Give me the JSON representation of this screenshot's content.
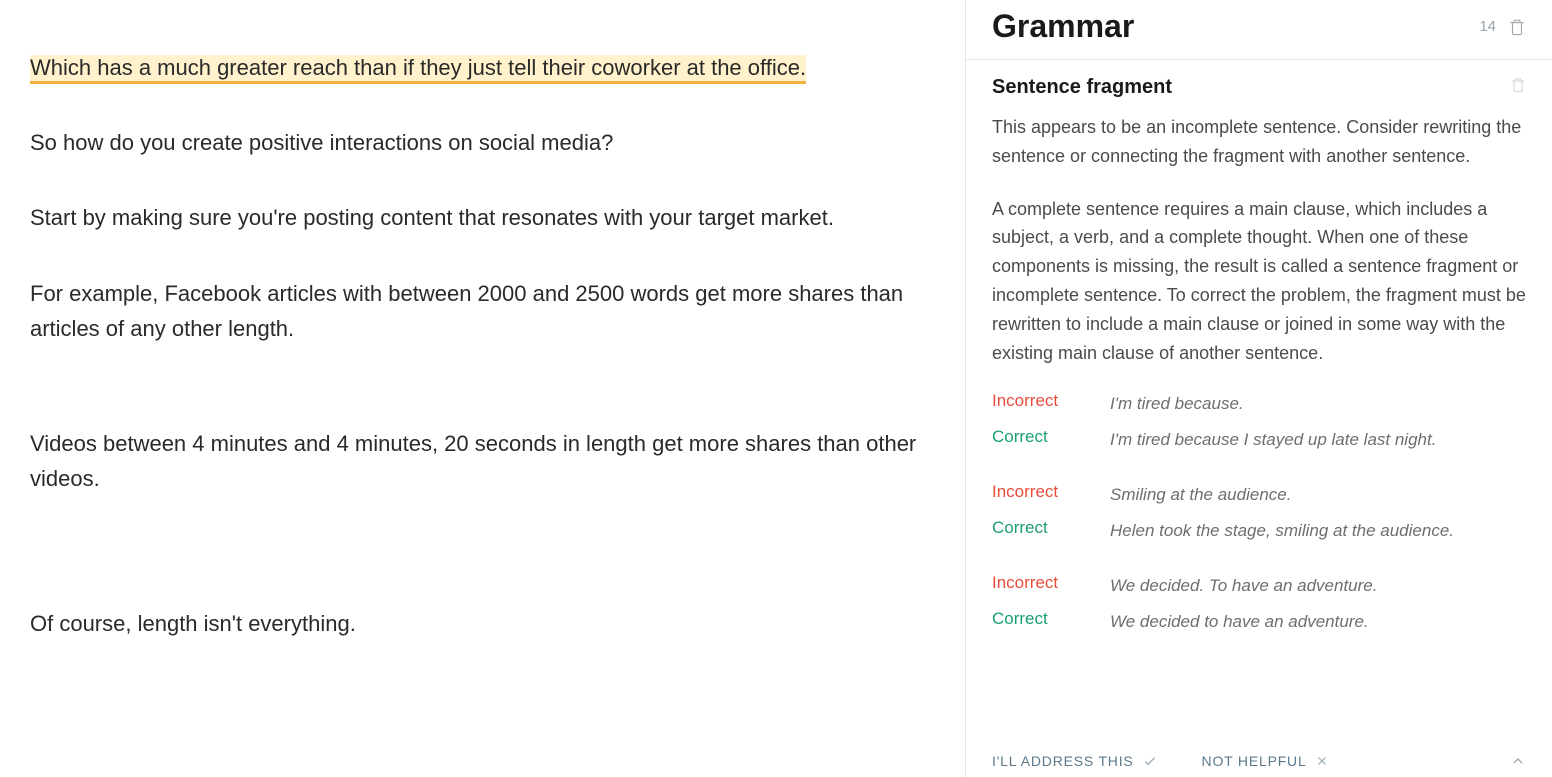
{
  "editor": {
    "highlighted": "Which has a much greater reach than if they just tell their coworker at the office.",
    "paragraphs": [
      "So how do you create positive interactions on social media?",
      "Start by making sure you're posting content that resonates with your target market.",
      "For example, Facebook articles with between 2000 and 2500 words get more shares than articles of any other length.",
      "Videos between 4 minutes and 4 minutes, 20 seconds in length get more shares than other videos.",
      "Of course, length isn't everything."
    ]
  },
  "sidebar": {
    "title": "Grammar",
    "count": "14",
    "issue_title": "Sentence fragment",
    "description_1": "This appears to be an incomplete sentence. Consider rewriting the sentence or connecting the fragment with another sentence.",
    "description_2": "A complete sentence requires a main clause, which includes a subject, a verb, and a complete thought. When one of these components is missing, the result is called a sentence fragment or incomplete sentence. To correct the problem, the fragment must be rewritten to include a main clause or joined in some way with the existing main clause of another sentence.",
    "labels": {
      "incorrect": "Incorrect",
      "correct": "Correct"
    },
    "examples": [
      {
        "incorrect": "I'm tired because.",
        "correct": "I'm tired because I stayed up late last night."
      },
      {
        "incorrect": "Smiling at the audience.",
        "correct": "Helen took the stage, smiling at the audience."
      },
      {
        "incorrect": "We decided. To have an adventure.",
        "correct": "We decided to have an adventure."
      }
    ],
    "footer": {
      "address": "I'LL ADDRESS THIS",
      "not_helpful": "NOT HELPFUL"
    }
  }
}
